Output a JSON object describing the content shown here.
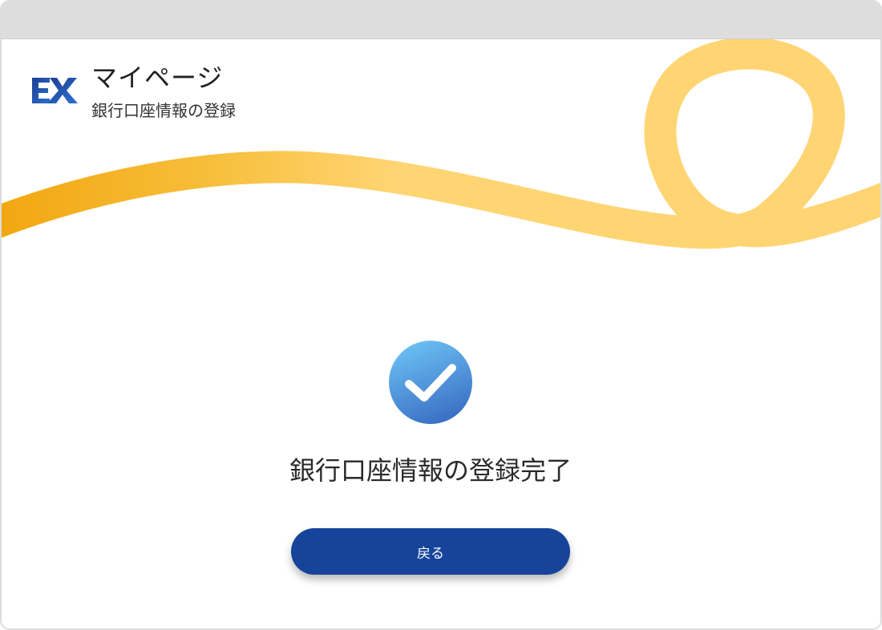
{
  "header": {
    "logo_text": "EX",
    "title": "マイページ",
    "subtitle": "銀行口座情報の登録"
  },
  "main": {
    "status_icon": "checkmark-circle-icon",
    "message": "銀行口座情報の登録完了",
    "back_button_label": "戻る"
  },
  "colors": {
    "brand_blue": "#16449a",
    "check_gradient_top": "#6cc3f5",
    "check_gradient_bottom": "#3b6fc4",
    "ribbon_dark": "#f2a60f",
    "ribbon_light": "#ffd574"
  }
}
